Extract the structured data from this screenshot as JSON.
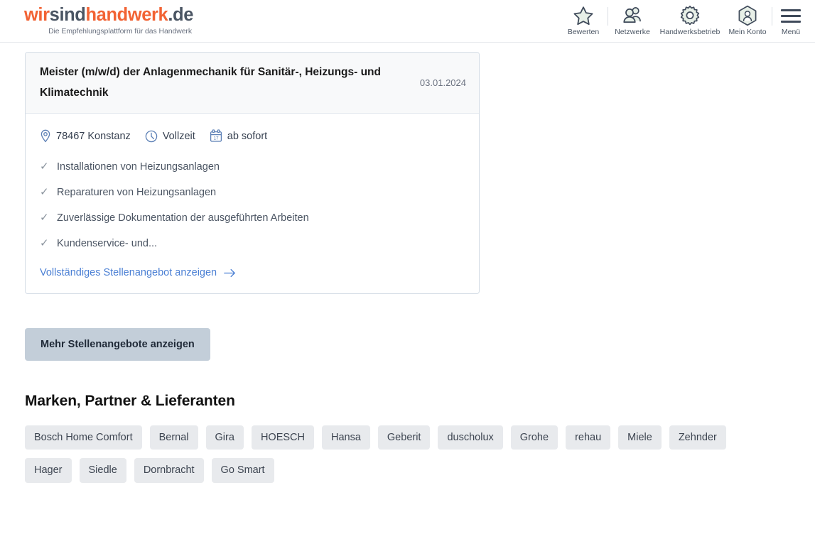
{
  "header": {
    "logo": {
      "part1": "wir",
      "part2": "sind",
      "part3": "handwerk",
      "part4": ".de",
      "tagline": "Die Empfehlungsplattform für das Handwerk",
      "orange": "#f26334",
      "dark": "#4a5563"
    },
    "nav": [
      {
        "icon": "star-icon",
        "label": "Bewerten"
      },
      {
        "icon": "people-icon",
        "label": "Netzwerke"
      },
      {
        "icon": "gear-icon",
        "label": "Handwerksbetrieb"
      },
      {
        "icon": "hexagon-account-icon",
        "label": "Mein Konto"
      },
      {
        "icon": "hamburger-icon",
        "label": "Menü"
      }
    ]
  },
  "job_card": {
    "title": "Meister (m/w/d) der Anlagenmechanik für Sanitär-, Heizungs- und Klimatechnik",
    "date": "03.01.2024",
    "meta": [
      {
        "icon": "location-pin-icon",
        "text": "78467 Konstanz"
      },
      {
        "icon": "clock-icon",
        "text": "Vollzeit"
      },
      {
        "icon": "calendar-icon",
        "text": "ab sofort"
      }
    ],
    "bullets": [
      "Installationen von Heizungsanlagen",
      "Reparaturen von Heizungsanlagen",
      "Zuverlässige Dokumentation der ausgeführten Arbeiten",
      "Kundenservice- und..."
    ],
    "link_label": "Vollständiges Stellenangebot anzeigen"
  },
  "more_button": {
    "label": "Mehr Stellenangebote anzeigen"
  },
  "brands": {
    "title": "Marken, Partner & Lieferanten",
    "tags": [
      "Bosch Home Comfort",
      "Bernal",
      "Gira",
      "HOESCH",
      "Hansa",
      "Geberit",
      "duscholux",
      "Grohe",
      "rehau",
      "Miele",
      "Zehnder",
      "Hager",
      "Siedle",
      "Dornbracht",
      "Go Smart"
    ]
  },
  "colors": {
    "accent_orange": "#f26334",
    "link_blue": "#4a7fd4",
    "button_bg": "#c3ced9",
    "tag_bg": "#e8eaed",
    "icon_stroke": "#3f4a5a",
    "icon_fill": "#e3ece4"
  }
}
